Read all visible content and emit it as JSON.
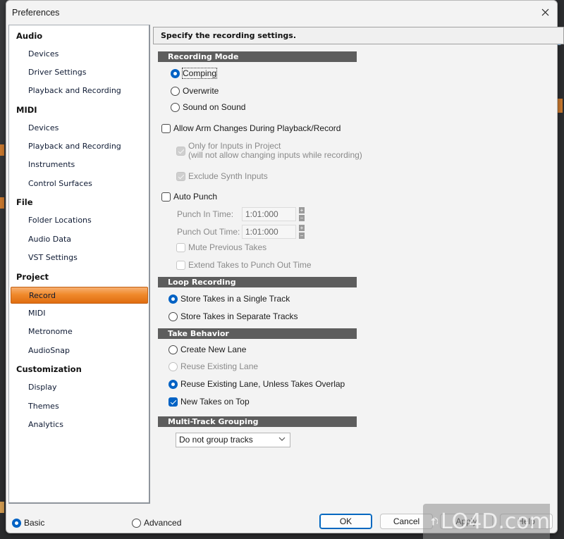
{
  "window": {
    "title": "Preferences",
    "close_icon": "close-icon"
  },
  "sidebar": {
    "groups": [
      {
        "label": "Audio",
        "items": [
          "Devices",
          "Driver Settings",
          "Playback and Recording"
        ]
      },
      {
        "label": "MIDI",
        "items": [
          "Devices",
          "Playback and Recording",
          "Instruments",
          "Control Surfaces"
        ]
      },
      {
        "label": "File",
        "items": [
          "Folder Locations",
          "Audio Data",
          "VST Settings"
        ]
      },
      {
        "label": "Project",
        "items": [
          "Record",
          "MIDI",
          "Metronome",
          "AudioSnap"
        ]
      },
      {
        "label": "Customization",
        "items": [
          "Display",
          "Themes",
          "Analytics"
        ]
      }
    ],
    "selected": "Project > Record",
    "selected_color": "#f08a2c"
  },
  "main": {
    "header": "Specify the recording settings.",
    "recording_mode": {
      "title": "Recording Mode",
      "options": [
        "Comping",
        "Overwrite",
        "Sound on Sound"
      ],
      "selected": "Comping"
    },
    "allow_arm_changes": {
      "label": "Allow Arm Changes During Playback/Record",
      "checked": false
    },
    "only_inputs_in_project": {
      "label_line1": "Only for Inputs in Project",
      "label_line2": "(will not allow changing inputs while recording)",
      "checked": true,
      "disabled": true
    },
    "exclude_synth_inputs": {
      "label": "Exclude Synth Inputs",
      "checked": true,
      "disabled": true
    },
    "auto_punch": {
      "label": "Auto Punch",
      "checked": false
    },
    "punch_in": {
      "label": "Punch In Time:",
      "value": "1:01:000"
    },
    "punch_out": {
      "label": "Punch Out Time:",
      "value": "1:01:000"
    },
    "mute_previous_takes": {
      "label": "Mute Previous Takes",
      "checked": false,
      "disabled": true
    },
    "extend_takes": {
      "label": "Extend Takes to Punch Out Time",
      "checked": false,
      "disabled": true
    },
    "loop_recording": {
      "title": "Loop Recording",
      "options": [
        "Store Takes in a Single Track",
        "Store Takes in Separate Tracks"
      ],
      "selected": "Store Takes in a Single Track"
    },
    "take_behavior": {
      "title": "Take Behavior",
      "options": [
        "Create New Lane",
        "Reuse Existing Lane",
        "Reuse Existing Lane, Unless Takes Overlap"
      ],
      "selected": "Reuse Existing Lane, Unless Takes Overlap",
      "disabled_option": "Reuse Existing Lane"
    },
    "new_takes_on_top": {
      "label": "New Takes on Top",
      "checked": true
    },
    "multi_track_grouping": {
      "title": "Multi-Track Grouping",
      "selected": "Do not group tracks"
    }
  },
  "footer": {
    "mode_options": [
      "Basic",
      "Advanced"
    ],
    "mode_selected": "Basic",
    "buttons": {
      "ok": "OK",
      "cancel": "Cancel",
      "apply": "Apply",
      "help": "Help"
    }
  },
  "watermark": "LO4D.com",
  "accent_color": "#0062c4"
}
